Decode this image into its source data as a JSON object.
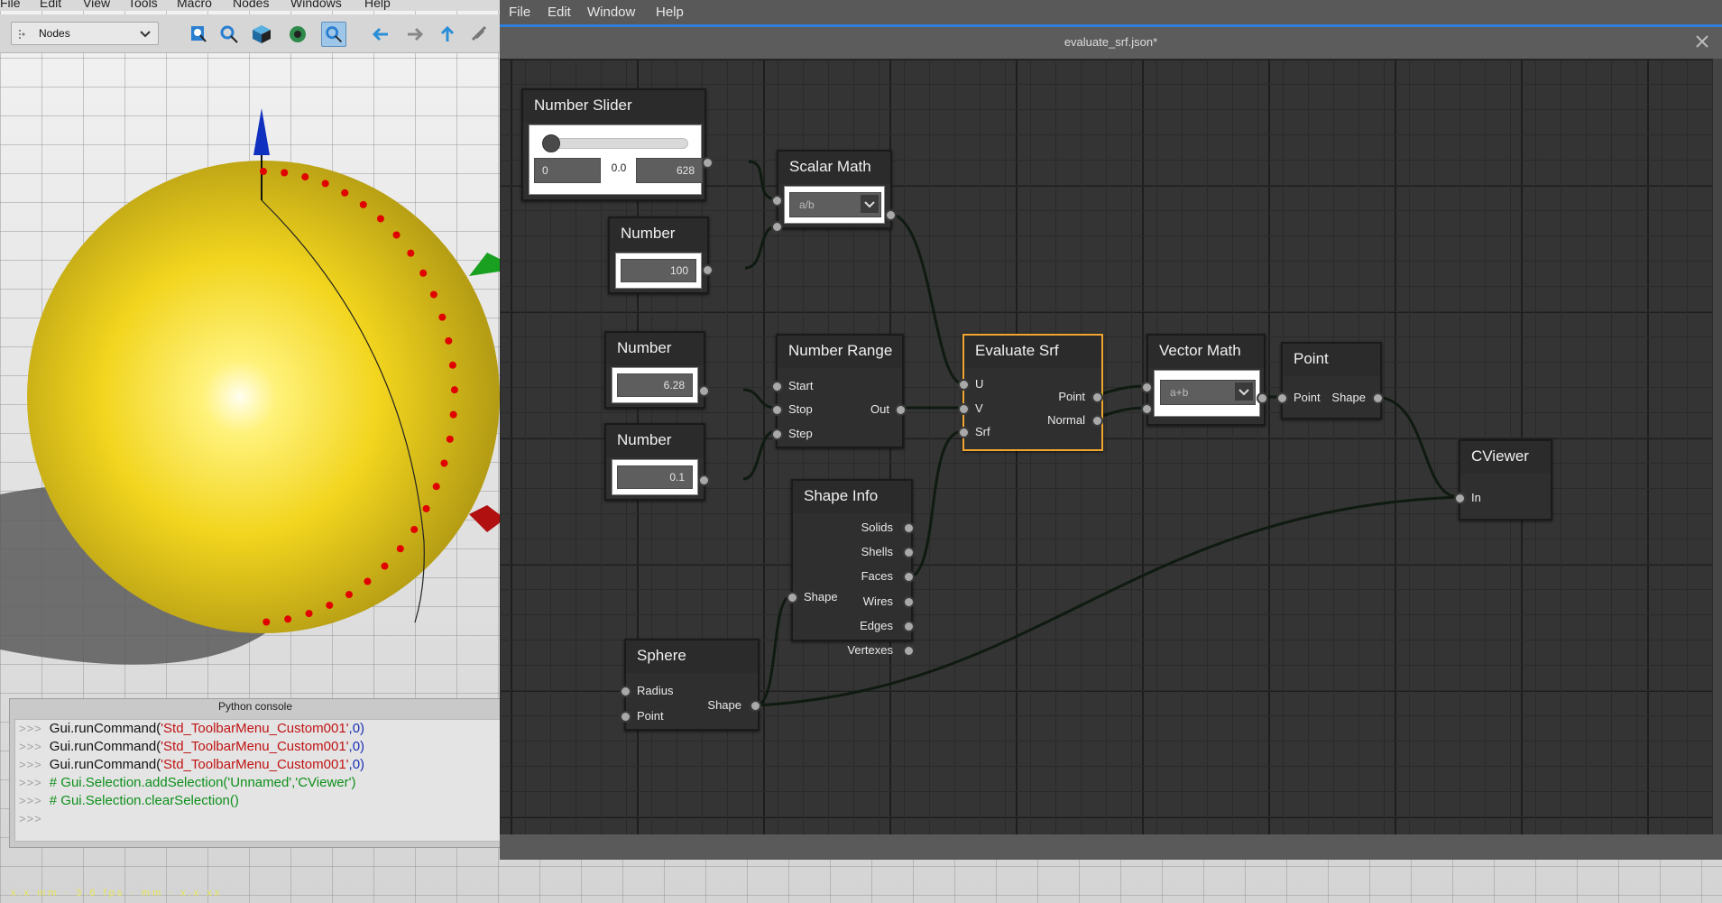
{
  "app": {
    "freecad_menu": [
      "File",
      "Edit",
      "View",
      "Tools",
      "Macro",
      "Nodes",
      "Windows",
      "Help"
    ],
    "workbench_select": "Nodes",
    "status_text": "x.x mm · 3.6 fps · mm · x.x xx"
  },
  "python_console": {
    "title": "Python console",
    "prompt": ">>>",
    "lines": [
      {
        "pre": "Gui.runCommand(",
        "str": "'Std_ToolbarMenu_Custom001'",
        "post": ",0)"
      },
      {
        "pre": "Gui.runCommand(",
        "str": "'Std_ToolbarMenu_Custom001'",
        "post": ",0)"
      },
      {
        "pre": "Gui.runCommand(",
        "str": "'Std_ToolbarMenu_Custom001'",
        "post": ",0)"
      },
      {
        "comment": "# Gui.Selection.addSelection('Unnamed','CViewer')"
      },
      {
        "comment": "# Gui.Selection.clearSelection()"
      }
    ]
  },
  "node_editor": {
    "menu": [
      "File",
      "Edit",
      "Window",
      "Help"
    ],
    "title": "evaluate_srf.json*",
    "nodes": {
      "number_slider": {
        "title": "Number Slider",
        "min": "0",
        "value": "0.0",
        "max": "628"
      },
      "scalar_math": {
        "title": "Scalar Math",
        "op": "a/b"
      },
      "number_100": {
        "title": "Number",
        "value": "100"
      },
      "number_628": {
        "title": "Number",
        "value": "6.28"
      },
      "number_01": {
        "title": "Number",
        "value": "0.1"
      },
      "number_range": {
        "title": "Number Range",
        "inputs": [
          "Start",
          "Stop",
          "Step"
        ],
        "output": "Out"
      },
      "evaluate_srf": {
        "title": "Evaluate Srf",
        "inputs": [
          "U",
          "V",
          "Srf"
        ],
        "outputs": [
          "Point",
          "Normal"
        ]
      },
      "vector_math": {
        "title": "Vector Math",
        "op": "a+b"
      },
      "point": {
        "title": "Point",
        "input": "Point",
        "output": "Shape"
      },
      "shape_info": {
        "title": "Shape Info",
        "input": "Shape",
        "outputs": [
          "Solids",
          "Shells",
          "Faces",
          "Wires",
          "Edges",
          "Vertexes"
        ]
      },
      "sphere": {
        "title": "Sphere",
        "inputs": [
          "Radius",
          "Point"
        ],
        "output": "Shape"
      },
      "cviewer": {
        "title": "CViewer",
        "input": "In"
      }
    },
    "selected_node": "Evaluate Srf"
  },
  "colors": {
    "sphere": "#f2d51e",
    "selection_border": "#f0a630",
    "menu_accent": "#2e7fd9",
    "path_dots": "#e00000"
  }
}
